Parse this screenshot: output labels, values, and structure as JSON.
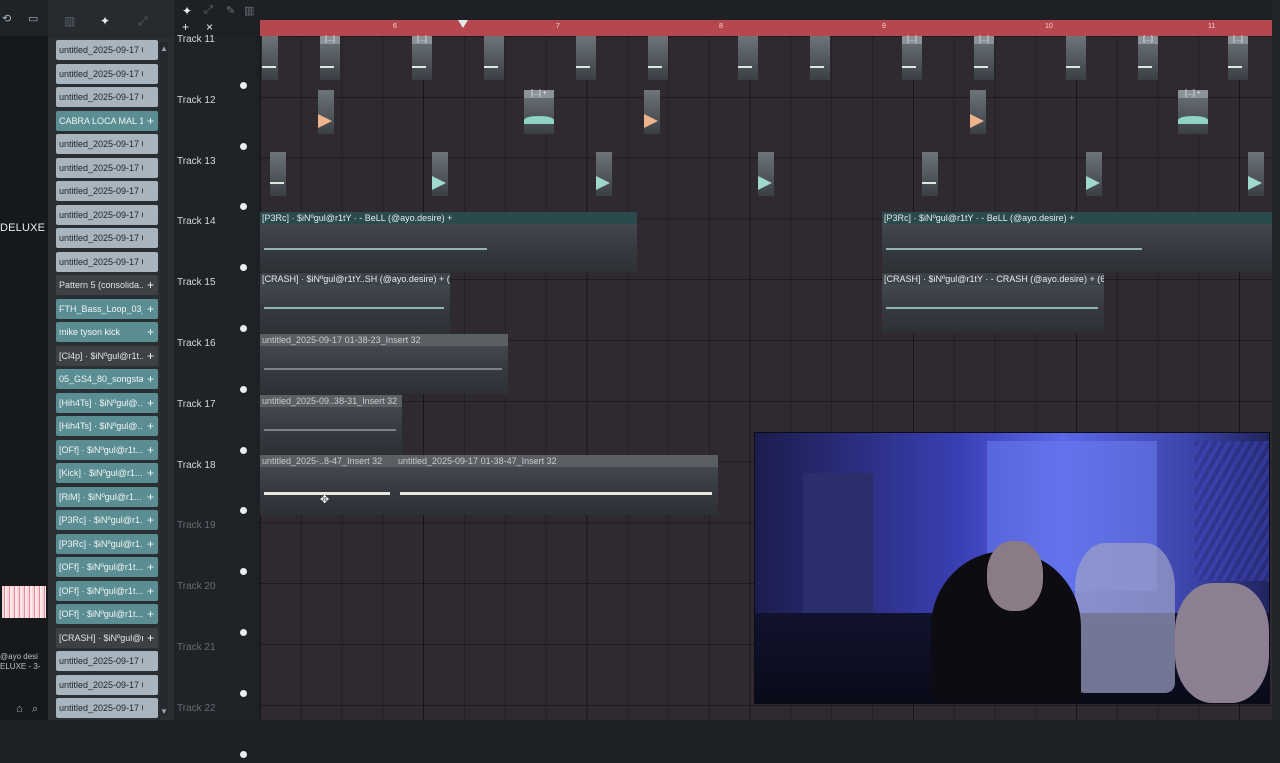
{
  "left_strip": {
    "brand_text": "DELUXE",
    "tiny_label_1": "@ayo desi",
    "tiny_label_2": "ELUXE - 3-"
  },
  "picker": {
    "clips": [
      {
        "label": "untitled_2025-09-17 00...",
        "style": "light"
      },
      {
        "label": "untitled_2025-09-17 00...",
        "style": "light"
      },
      {
        "label": "untitled_2025-09-17 00...",
        "style": "light"
      },
      {
        "label": "CABRA LOCA MAL 180...",
        "style": "teal"
      },
      {
        "label": "untitled_2025-09-17 00...",
        "style": "light"
      },
      {
        "label": "untitled_2025-09-17 00...",
        "style": "light"
      },
      {
        "label": "untitled_2025-09-17 00...",
        "style": "light"
      },
      {
        "label": "untitled_2025-09-17 00...",
        "style": "light"
      },
      {
        "label": "untitled_2025-09-17 00...",
        "style": "light"
      },
      {
        "label": "untitled_2025-09-17 00...",
        "style": "light"
      },
      {
        "label": "Pattern 5 (consolida...",
        "style": "dark"
      },
      {
        "label": "FTH_Bass_Loop_03_...",
        "style": "teal"
      },
      {
        "label": "mike tyson kick",
        "style": "teal"
      },
      {
        "label": "[Cl4p] · $iNºgul@r1t...",
        "style": "dark"
      },
      {
        "label": "05_GS4_80_songsta...",
        "style": "teal"
      },
      {
        "label": "[Hih4Ts] · $iNºgul@...",
        "style": "teal"
      },
      {
        "label": "[Hih4Ts] · $iNºgul@...",
        "style": "teal"
      },
      {
        "label": "[OFf] · $iNºgul@r1t...",
        "style": "teal"
      },
      {
        "label": "[Kick] · $iNºgul@r1...",
        "style": "teal"
      },
      {
        "label": "[RiM] · $iNºgul@r1...",
        "style": "teal"
      },
      {
        "label": "[P3Rc] · $iNºgul@r1...",
        "style": "teal"
      },
      {
        "label": "[P3Rc] · $iNºgul@r1...",
        "style": "teal"
      },
      {
        "label": "[OFf] · $iNºgul@r1t...",
        "style": "teal"
      },
      {
        "label": "[OFf] · $iNºgul@r1t...",
        "style": "teal"
      },
      {
        "label": "[OFf] · $iNºgul@r1t...",
        "style": "teal"
      },
      {
        "label": "[CRASH] · $iNºgul@r...",
        "style": "dark"
      },
      {
        "label": "untitled_2025-09-17 01...",
        "style": "light"
      },
      {
        "label": "untitled_2025-09-17 01...",
        "style": "light"
      },
      {
        "label": "untitled_2025-09-17 01...",
        "style": "light"
      }
    ]
  },
  "tracks": [
    {
      "name": "Track 11"
    },
    {
      "name": "Track 12"
    },
    {
      "name": "Track 13"
    },
    {
      "name": "Track 14"
    },
    {
      "name": "Track 15"
    },
    {
      "name": "Track 16"
    },
    {
      "name": "Track 17"
    },
    {
      "name": "Track 18"
    },
    {
      "name": "Track 19"
    },
    {
      "name": "Track 20"
    },
    {
      "name": "Track 21"
    },
    {
      "name": "Track 22"
    }
  ],
  "timeline": {
    "bars": [
      "6",
      "7",
      "8",
      "9",
      "10",
      "11"
    ]
  },
  "segments": {
    "t11_label": "[...]",
    "t12_label_a": "[...] +",
    "t12_label_b": "[...] +",
    "t14_a": "[P3Rc] · $iNºgul@r1tY · - BeLL (@ayo.desire) +",
    "t14_b": "[P3Rc] · $iNºgul@r1tY · - BeLL (@ayo.desire) +",
    "t15_a": "[CRASH] · $iNºgul@r1tY..SH (@ayo.desire) + (6)",
    "t15_b": "[CRASH] · $iNºgul@r1tY · - CRASH (@ayo.desire) + (6)",
    "t16": "untitled_2025-09-17 01-38-23_Insert 32",
    "t17": "untitled_2025-09..38-31_Insert 32",
    "t18_a": "untitled_2025-..8-47_Insert 32",
    "t18_b": "untitled_2025-09-17 01-38-47_Insert 32"
  },
  "colors": {
    "timeline": "#b6474f",
    "playlist_bg": "#2e2a30",
    "teal_clip": "#5a8e92",
    "light_clip": "#a8b5bf"
  }
}
